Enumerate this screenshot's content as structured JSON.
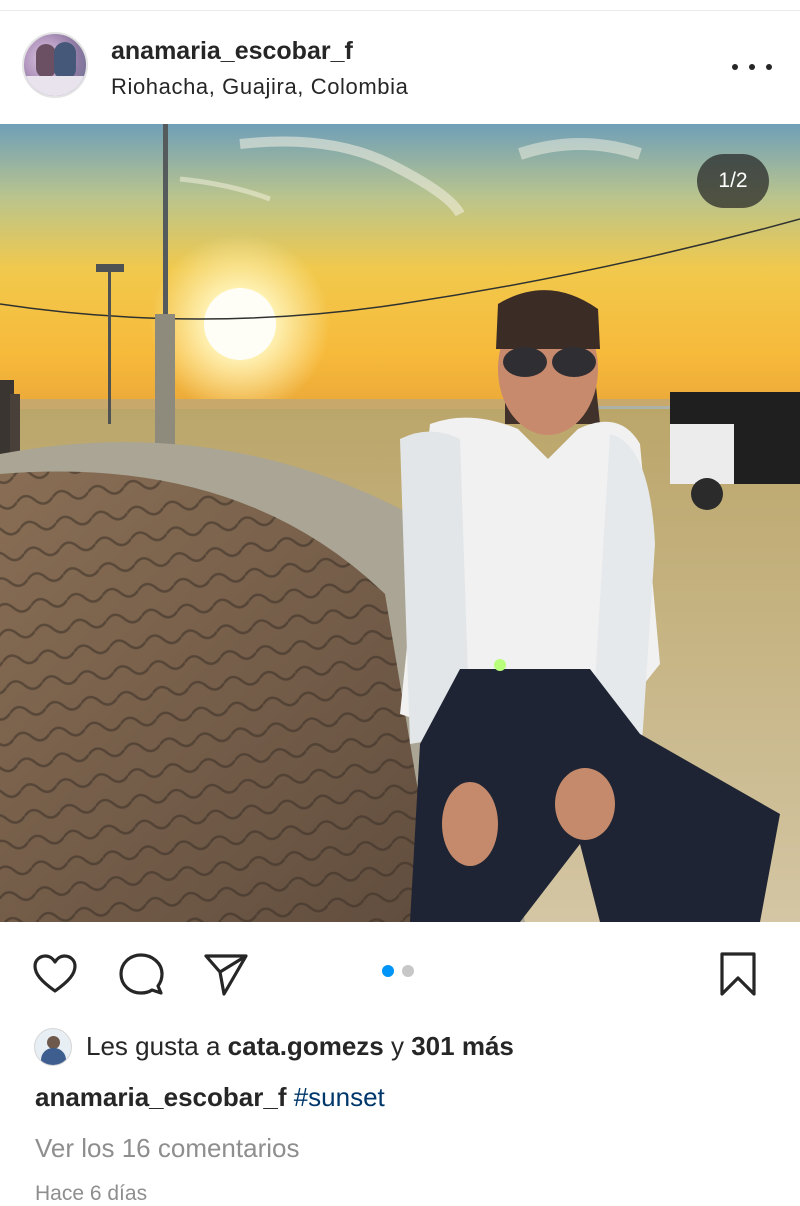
{
  "post": {
    "username": "anamaria_escobar_f",
    "location": "Riohacha, Guajira, Colombia",
    "more_icon": "more-horizontal-icon",
    "image_counter": "1/2",
    "image_description_icon": "photo",
    "carousel": {
      "count": 2,
      "active": 0,
      "active_color": "#0095f6",
      "inactive_color": "#c7c7c7"
    }
  },
  "actions": {
    "like_icon": "heart-icon",
    "comment_icon": "comment-icon",
    "share_icon": "send-icon",
    "save_icon": "bookmark-icon"
  },
  "likes": {
    "prefix": "Les gusta a",
    "user": "cata.gomezs",
    "connector": "y",
    "count": "301 más"
  },
  "caption": {
    "username": "anamaria_escobar_f",
    "hashtag": "#sunset"
  },
  "comments_link": "Ver los 16 comentarios",
  "timestamp": "Hace 6 días",
  "colors": {
    "text": "#262626",
    "secondary": "#8e8e8e",
    "link": "#00376b",
    "accent": "#0095f6"
  }
}
